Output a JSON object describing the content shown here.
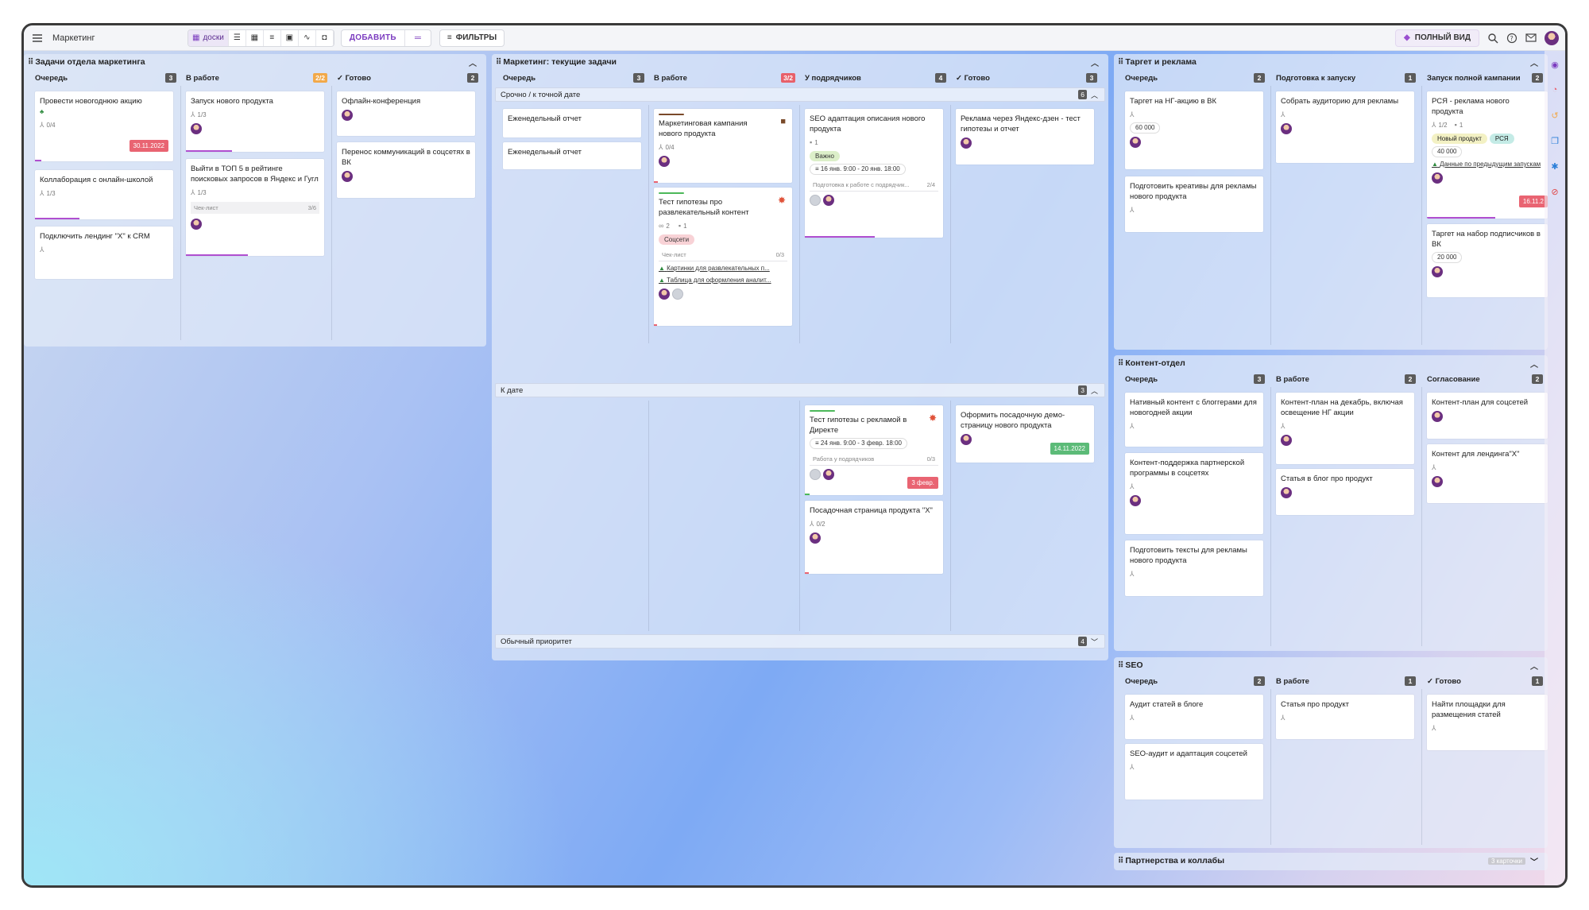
{
  "app": {
    "title": "Маркетинг",
    "views_label": "доски",
    "add_label": "ДОБАВИТЬ",
    "filters_label": "ФИЛЬТРЫ",
    "fullview_label": "ПОЛНЫЙ ВИД"
  },
  "colors": {
    "accent": "#7b3bbf",
    "overdue": "#e96472",
    "done": "#5cbb78",
    "counter_orange": "#f2a94a"
  },
  "board1": {
    "title": "Задачи отдела маркетинга",
    "cols": [
      {
        "name": "Очередь",
        "count": "3"
      },
      {
        "name": "В работе",
        "count": "2/2"
      },
      {
        "name": "✓ Готово",
        "count": "2"
      }
    ],
    "cards": {
      "c1": {
        "title": "Провести новогоднюю акцию",
        "sub": "0/4",
        "date": "30.11.2022"
      },
      "c2": {
        "title": "Коллаборация с онлайн-школой",
        "sub": "1/3"
      },
      "c3": {
        "title": "Подключить лендинг \"X\" к CRM"
      },
      "c4": {
        "title": "Запуск нового продукта",
        "sub": "1/3"
      },
      "c5": {
        "title": "Выйти в ТОП 5 в рейтинге поисковых запросов в Яндекс и Гугл",
        "sub": "1/3",
        "checklist": "Чек-лист",
        "checkcount": "3/6"
      },
      "c6": {
        "title": "Офлайн-конференция"
      },
      "c7": {
        "title": "Перенос коммуникаций в соцсетях в ВК"
      }
    }
  },
  "board2": {
    "title": "Маркетинг: текущие задачи",
    "cols": [
      {
        "name": "Очередь",
        "count": "3"
      },
      {
        "name": "В работе",
        "count": "3/2"
      },
      {
        "name": "У подрядчиков",
        "count": "4"
      },
      {
        "name": "✓ Готово",
        "count": "3"
      }
    ],
    "lanes": {
      "l1": {
        "name": "Срочно / к точной дате",
        "count": "6"
      },
      "l2": {
        "name": "К дате",
        "count": "3"
      },
      "l3": {
        "name": "Обычный приоритет",
        "count": "4"
      }
    },
    "cards": {
      "d1": {
        "title": "Еженедельный отчет"
      },
      "d2": {
        "title": "Еженедельный отчет"
      },
      "d3": {
        "title": "Маркетинговая кампания нового продукта",
        "sub": "0/4"
      },
      "d4": {
        "title": "Тест гипотезы про развлекательный контент",
        "sub1": "2",
        "sub2": "1",
        "tag": "Соцсети",
        "checklist": "Чек-лист",
        "checkcount": "0/3",
        "link1": "Картинки для развлекательных п...",
        "link2": "Таблица для оформления аналит..."
      },
      "d5": {
        "title": "SEO адаптация описания нового продукта",
        "sub": "1",
        "tag": "Важно",
        "date": "16 янв. 9:00 - 20 янв. 18:00",
        "checklist": "Подготовка к работе с подрядчик...",
        "checkcount": "2/4"
      },
      "d6": {
        "title": "Реклама через Яндекс-дзен - тест гипотезы и отчет"
      },
      "d7": {
        "title": "Тест гипотезы с рекламой в Директе",
        "date": "24 янв. 9:00 - 3 февр. 18:00",
        "checklist": "Работа у подрядчиков",
        "checkcount": "0/3",
        "badge": "3 февр."
      },
      "d8": {
        "title": "Посадочная страница продукта \"X\"",
        "sub": "0/2"
      },
      "d9": {
        "title": "Оформить посадочную демо-страницу нового продукта",
        "badge": "14.11.2022"
      }
    }
  },
  "board3": {
    "title": "Таргет и реклама",
    "cols": [
      {
        "name": "Очередь",
        "count": "2"
      },
      {
        "name": "Подготовка к запуску",
        "count": "1"
      },
      {
        "name": "Запуск полной кампании",
        "count": "2"
      }
    ],
    "cards": {
      "e1": {
        "title": "Таргет на НГ-акцию в ВК",
        "pill": "60 000"
      },
      "e2": {
        "title": "Подготовить креативы для рекламы нового продукта"
      },
      "e3": {
        "title": "Собрать аудиторию для рекламы"
      },
      "e4": {
        "title": "РСЯ - реклама нового продукта",
        "sub1": "1/2",
        "sub2": "1",
        "tag1": "Новый продукт",
        "tag2": "РСЯ",
        "pill": "40 000",
        "link": "Данные по предыдущим запускам",
        "badge": "16.11.2"
      },
      "e5": {
        "title": "Таргет на набор подписчиков в ВК",
        "pill": "20 000"
      }
    }
  },
  "board4": {
    "title": "Контент-отдел",
    "cols": [
      {
        "name": "Очередь",
        "count": "3"
      },
      {
        "name": "В работе",
        "count": "2"
      },
      {
        "name": "Согласование",
        "count": "2"
      }
    ],
    "cards": {
      "f1": {
        "title": "Нативный контент с блоггерами для новогодней акции"
      },
      "f2": {
        "title": "Контент-поддержка партнерской программы в соцсетях"
      },
      "f3": {
        "title": "Подготовить тексты для рекламы нового продукта"
      },
      "f4": {
        "title": "Контент-план на декабрь, включая освещение НГ акции"
      },
      "f5": {
        "title": "Статья в блог про продукт"
      },
      "f6": {
        "title": "Контент-план для соцсетей"
      },
      "f7": {
        "title": "Контент для лендинга\"X\""
      }
    }
  },
  "board5": {
    "title": "SEO",
    "cols": [
      {
        "name": "Очередь",
        "count": "2"
      },
      {
        "name": "В работе",
        "count": "1"
      },
      {
        "name": "✓ Готово",
        "count": "1"
      }
    ],
    "cards": {
      "g1": {
        "title": "Аудит статей в блоге"
      },
      "g2": {
        "title": "SEO-аудит и адаптация соцсетей"
      },
      "g3": {
        "title": "Статья про продукт"
      },
      "g4": {
        "title": "Найти площадки для размещения статей"
      }
    }
  },
  "board6": {
    "title": "Партнерства и коллабы",
    "count": "3 карточки"
  }
}
